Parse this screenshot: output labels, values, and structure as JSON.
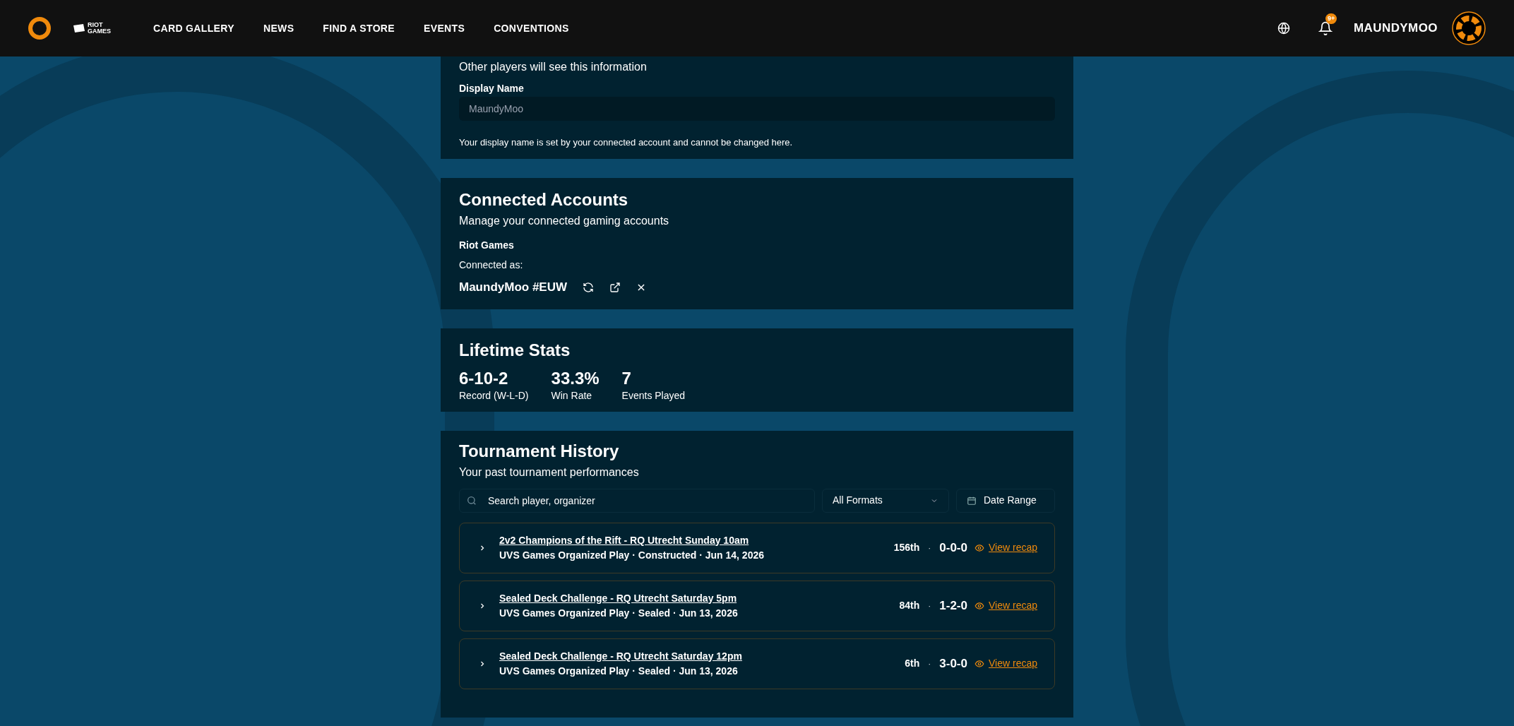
{
  "nav": {
    "brand_lines": [
      "RIOT",
      "GAMES"
    ],
    "links": [
      {
        "label": "CARD GALLERY"
      },
      {
        "label": "NEWS"
      },
      {
        "label": "FIND A STORE"
      },
      {
        "label": "EVENTS"
      },
      {
        "label": "CONVENTIONS"
      }
    ],
    "notification_badge": "9+",
    "username": "MAUNDYMOO"
  },
  "profile_card": {
    "subtitle": "Other players will see this information",
    "field_label": "Display Name",
    "field_value": "MaundyMoo",
    "help": "Your display name is set by your connected account and cannot be changed here."
  },
  "connected_accounts": {
    "title": "Connected Accounts",
    "subtitle": "Manage your connected gaming accounts",
    "provider": "Riot Games",
    "connected_as_label": "Connected as:",
    "account": "MaundyMoo #EUW"
  },
  "lifetime_stats": {
    "title": "Lifetime Stats",
    "stats": [
      {
        "value": "6-10-2",
        "label": "Record (W-L-D)"
      },
      {
        "value": "33.3%",
        "label": "Win Rate"
      },
      {
        "value": "7",
        "label": "Events Played"
      }
    ]
  },
  "tournament_history": {
    "title": "Tournament History",
    "subtitle": "Your past tournament performances",
    "search_placeholder": "Search player, organizer",
    "format_filter": "All Formats",
    "date_filter": "Date Range",
    "rows": [
      {
        "name": "2v2 Champions of the Rift - RQ Utrecht Sunday 10am",
        "details": "UVS Games Organized Play · Constructed · Jun 14, 2026",
        "placement": "156th",
        "separator": "·",
        "record": "0-0-0",
        "link": "View recap",
        "expanded": false
      },
      {
        "name": "Sealed Deck Challenge - RQ Utrecht Saturday 5pm",
        "details": "UVS Games Organized Play · Sealed · Jun 13, 2026",
        "placement": "84th",
        "separator": "·",
        "record": "1-2-0",
        "link": "View recap",
        "expanded": false
      },
      {
        "name": "Sealed Deck Challenge - RQ Utrecht Saturday 12pm",
        "details": "UVS Games Organized Play · Sealed · Jun 13, 2026",
        "placement": "6th",
        "separator": "·",
        "record": "3-0-0",
        "link": "View recap",
        "expanded": false
      }
    ]
  }
}
